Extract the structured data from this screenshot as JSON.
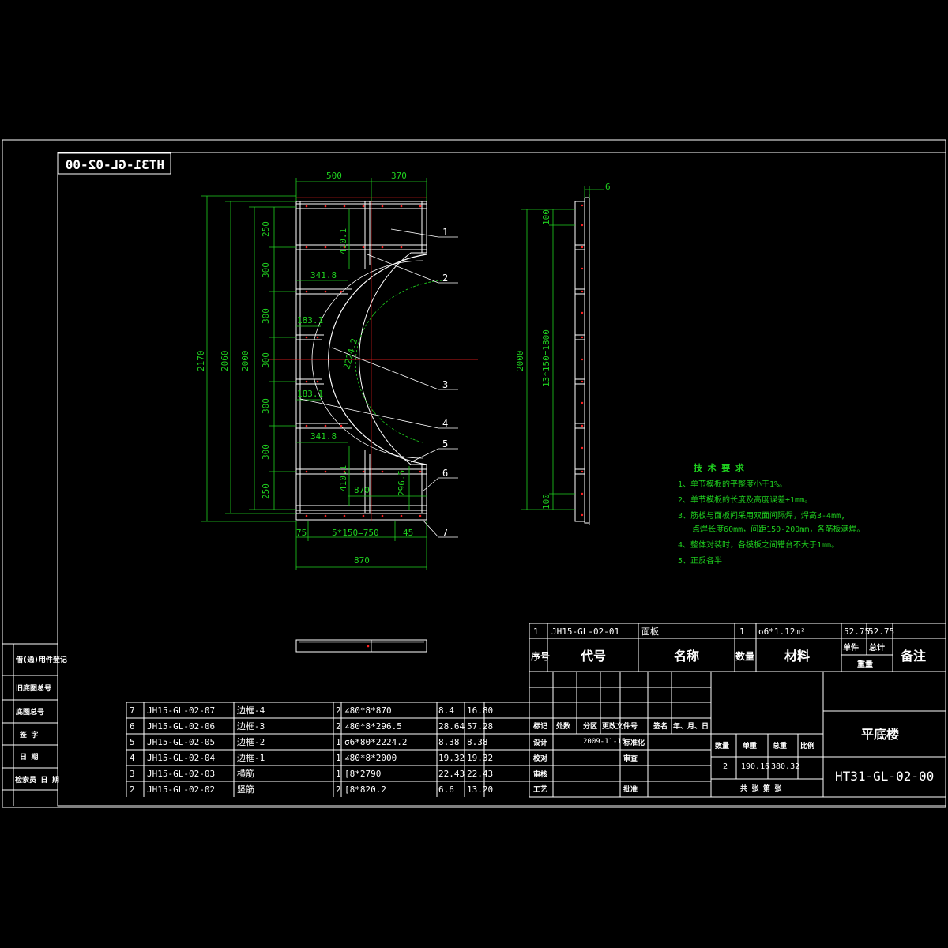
{
  "drawing_number": "HT31-GL-02-00",
  "drawing_number_mirrored": "HT31-GL-02-00",
  "drawing_name": "平底楼",
  "front_view": {
    "top_dims": [
      "500",
      "370"
    ],
    "left_dims": [
      "2170",
      "2060",
      "2000"
    ],
    "left_spacing": [
      "250",
      "300",
      "300",
      "300",
      "300",
      "300",
      "250"
    ],
    "inner_dims": {
      "d410_top": "410.1",
      "d341_top": "341.8",
      "d183_top": "183.1",
      "arc": "2224.2",
      "d183_bottom": "183.1",
      "d341_bottom": "341.8",
      "d410_bottom": "410.1",
      "d870_inner": "870",
      "d296": "296.5"
    },
    "bottom_dims": [
      "75",
      "5*150=750",
      "45"
    ],
    "bottom_total": "870",
    "balloons": [
      "1",
      "2",
      "3",
      "4",
      "5",
      "6",
      "7"
    ]
  },
  "side_view": {
    "thickness": "6",
    "dim_top": "100",
    "dim_mid": "13*150=1800",
    "dim_bottom": "100",
    "dim_total": "2000"
  },
  "tech_requirements": {
    "title": "技 术 要 求",
    "items": [
      "1、单节模板的平整度小于1%。",
      "2、单节模板的长度及高度误差±1mm。",
      "3、筋板与面板间采用双面间隔焊，焊高3-4mm,",
      "   点焊长度60mm，间距150-200mm，各筋板满焊。",
      "4、整体对装时，各模板之间错台不大于1mm。",
      "5、正反各半"
    ]
  },
  "parts_list": [
    {
      "no": "7",
      "code": "JH15-GL-02-07",
      "name": "边框-4",
      "qty": "2",
      "material": "∠80*8*870",
      "unit": "8.4",
      "total": "16.80"
    },
    {
      "no": "6",
      "code": "JH15-GL-02-06",
      "name": "边框-3",
      "qty": "2",
      "material": "∠80*8*296.5",
      "unit": "28.64",
      "total": "57.28"
    },
    {
      "no": "5",
      "code": "JH15-GL-02-05",
      "name": "边框-2",
      "qty": "1",
      "material": "σ6*80*2224.2",
      "unit": "8.38",
      "total": "8.38"
    },
    {
      "no": "4",
      "code": "JH15-GL-02-04",
      "name": "边框-1",
      "qty": "1",
      "material": "∠80*8*2000",
      "unit": "19.32",
      "total": "19.32"
    },
    {
      "no": "3",
      "code": "JH15-GL-02-03",
      "name": "横筋",
      "qty": "1",
      "material": "[8*2790",
      "unit": "22.43",
      "total": "22.43"
    },
    {
      "no": "2",
      "code": "JH15-GL-02-02",
      "name": "竖筋",
      "qty": "2",
      "material": "[8*820.2",
      "unit": "6.6",
      "total": "13.20"
    }
  ],
  "parts_row1": {
    "no": "1",
    "code": "JH15-GL-02-01",
    "name": "面板",
    "qty": "1",
    "material": "σ6*1.12m²",
    "unit": "52.75",
    "total": "52.75"
  },
  "parts_header": {
    "no": "序号",
    "code": "代号",
    "name": "名称",
    "qty": "数量",
    "material": "材料",
    "unit": "单件",
    "total": "总计",
    "weight": "重量",
    "remark": "备注"
  },
  "title_block": {
    "rev_labels": [
      "标记",
      "处数",
      "分区",
      "更改文件号",
      "签名",
      "年、月、日"
    ],
    "design_label": "设计",
    "design_date": "2009-11-15",
    "standard_label": "标准化",
    "check_label": "校对",
    "review_label": "审查",
    "audit_label": "审核",
    "process_label": "工艺",
    "approve_label": "批准",
    "qty_label": "数量",
    "unit_weight_label": "单重",
    "total_weight_label": "总重",
    "scale_label": "比例",
    "qty": "2",
    "unit_weight": "190.16",
    "total_weight": "380.32",
    "sheet_label": "共 张 第 张"
  },
  "left_strip": [
    "借(通)用件登记",
    "旧底图总号",
    "底图总号",
    "签 字",
    "日 期",
    "检索员 日 期"
  ]
}
